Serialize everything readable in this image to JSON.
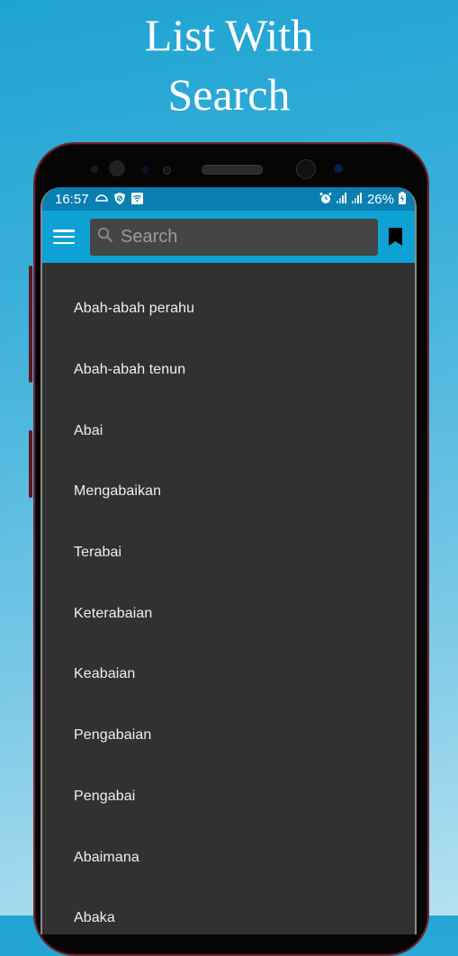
{
  "promo": {
    "title_line1": "List With",
    "title_line2": "Search"
  },
  "status_bar": {
    "time": "16:57",
    "left_icons": [
      "cloud-icon",
      "shield-block-icon",
      "wifi-box-icon"
    ],
    "right_icons": [
      "alarm-icon",
      "signal-icon",
      "signal-icon"
    ],
    "battery": "26%",
    "battery_icon": "battery-charging-icon"
  },
  "toolbar": {
    "menu_icon": "hamburger-menu-icon",
    "search_placeholder": "Search",
    "search_value": "",
    "bookmark_icon": "bookmark-icon"
  },
  "list": {
    "items": [
      "Abah-abah perahu",
      "Abah-abah tenun",
      "Abai",
      "Mengabaikan",
      "Terabai",
      "Keterabaian",
      "Keabaian",
      "Pengabaian",
      "Pengabai",
      "Abaimana",
      "Abaka"
    ]
  },
  "colors": {
    "toolbar": "#0ea2d4",
    "status_bar": "#0a7fb1",
    "list_background": "#313131",
    "search_field": "#454545",
    "phone_frame": "#6b2530"
  }
}
